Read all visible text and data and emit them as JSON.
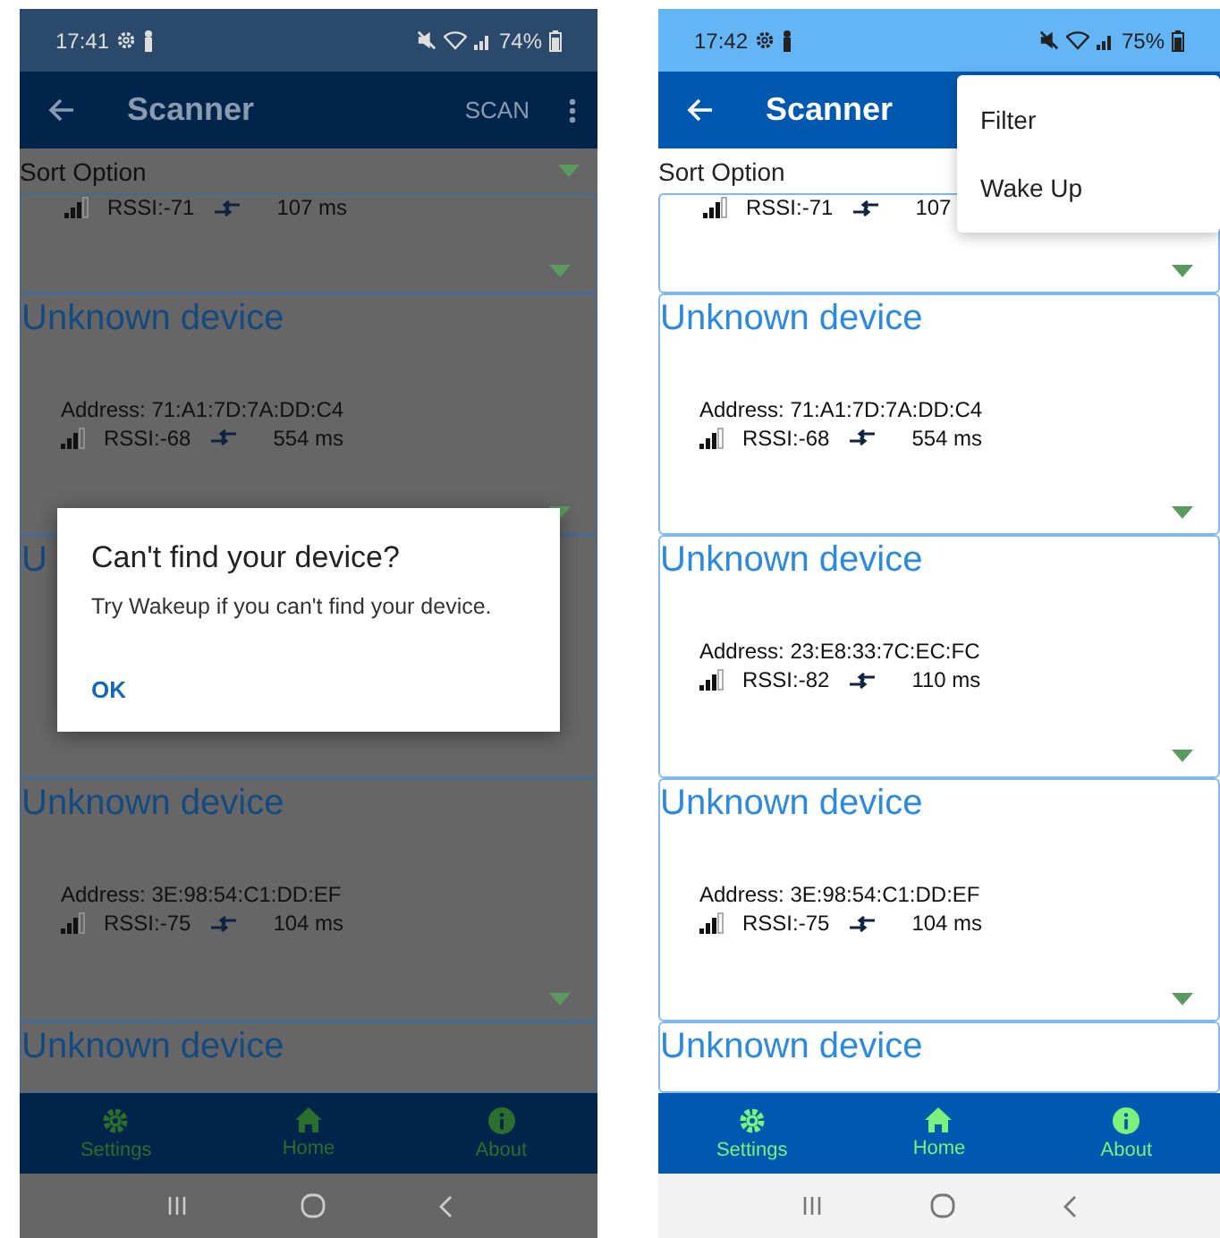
{
  "screens": [
    {
      "dimmed": true,
      "status_bar": {
        "time": "17:41",
        "battery": "74%"
      },
      "app_bar": {
        "title": "Scanner",
        "actions": [
          "SCAN"
        ],
        "overflow_button": true
      },
      "sort_option": {
        "label": "Sort Option"
      },
      "devices": [
        {
          "kind": "partial",
          "rssi": "RSSI:-71",
          "interval": "107 ms"
        },
        {
          "kind": "full",
          "name": "Unknown device",
          "address": "Address: 71:A1:7D:7A:DD:C4",
          "rssi": "RSSI:-68",
          "interval": "554 ms"
        },
        {
          "kind": "covered",
          "name": "U"
        },
        {
          "kind": "full",
          "name": "Unknown device",
          "address": "Address: 3E:98:54:C1:DD:EF",
          "rssi": "RSSI:-75",
          "interval": "104 ms"
        },
        {
          "kind": "title",
          "name": "Unknown device"
        }
      ],
      "dialog": {
        "title": "Can't find your device?",
        "message": "Try Wakeup if you can't find your device.",
        "button": "OK"
      },
      "bottom_nav": [
        {
          "kind": "settings",
          "label": "Settings"
        },
        {
          "kind": "home",
          "label": "Home"
        },
        {
          "kind": "about",
          "label": "About"
        }
      ]
    },
    {
      "dimmed": false,
      "status_bar": {
        "time": "17:42",
        "battery": "75%"
      },
      "app_bar": {
        "title": "Scanner"
      },
      "sort_option": {
        "label": "Sort Option"
      },
      "devices": [
        {
          "kind": "partial",
          "rssi": "RSSI:-71",
          "interval": "107"
        },
        {
          "kind": "full",
          "name": "Unknown device",
          "address": "Address: 71:A1:7D:7A:DD:C4",
          "rssi": "RSSI:-68",
          "interval": "554 ms"
        },
        {
          "kind": "full",
          "name": "Unknown device",
          "address": "Address: 23:E8:33:7C:EC:FC",
          "rssi": "RSSI:-82",
          "interval": "110 ms"
        },
        {
          "kind": "full",
          "name": "Unknown device",
          "address": "Address: 3E:98:54:C1:DD:EF",
          "rssi": "RSSI:-75",
          "interval": "104 ms"
        },
        {
          "kind": "title",
          "name": "Unknown device"
        }
      ],
      "menu": {
        "items": [
          "Filter",
          "Wake Up"
        ]
      },
      "bottom_nav": [
        {
          "kind": "settings",
          "label": "Settings"
        },
        {
          "kind": "home",
          "label": "Home"
        },
        {
          "kind": "about",
          "label": "About"
        }
      ]
    }
  ]
}
